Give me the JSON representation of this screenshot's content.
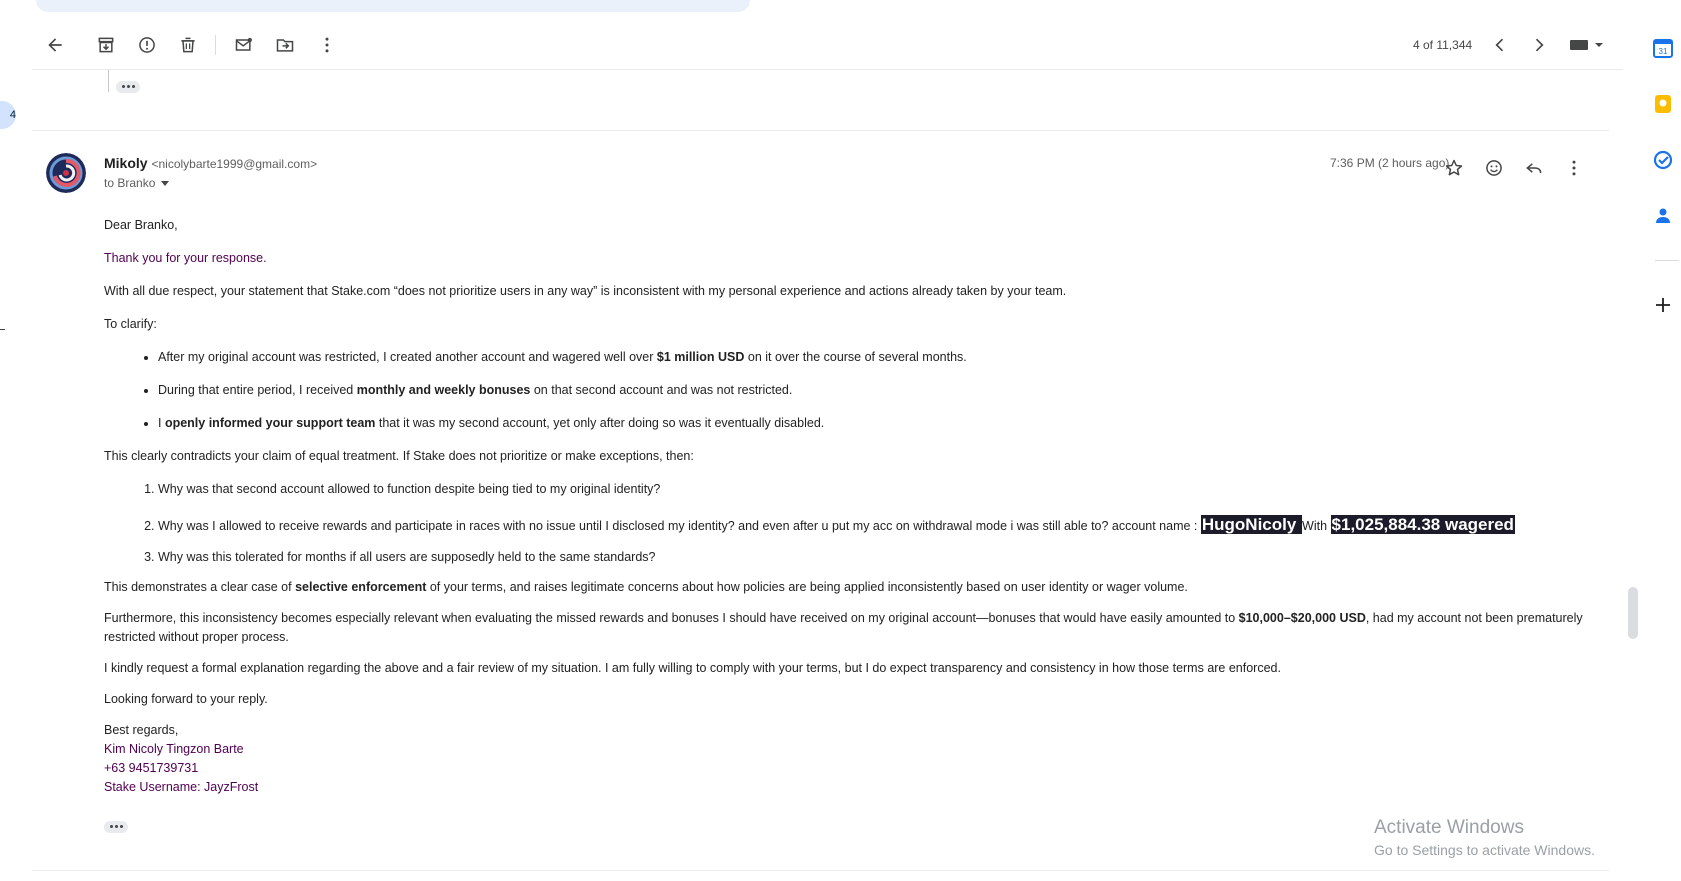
{
  "toolbar": {
    "back_icon": "arrow-left-icon",
    "archive_icon": "archive-icon",
    "spam_icon": "report-spam-icon",
    "delete_icon": "trash-icon",
    "mark_unread_icon": "mark-unread-icon",
    "move_icon": "move-to-icon",
    "more_icon": "more-vert-icon",
    "counter": "4 of 11,344",
    "older_icon": "chevron-left-icon",
    "newer_icon": "chevron-right-icon",
    "input_tools_icon": "keyboard-icon"
  },
  "message": {
    "sender_name": "Mikoly",
    "sender_email": "<nicolybarte1999@gmail.com>",
    "to": "to Branko",
    "timestamp": "7:36 PM (2 hours ago)",
    "greeting": "Dear Branko,",
    "thanks": "Thank you for your response.",
    "p1": "With all due respect, your statement that Stake.com “does not prioritize users in any way” is inconsistent with my personal experience and actions already taken by your team.",
    "clarify": "To clarify:",
    "bullets": [
      {
        "a": "After my original account was restricted, I created another account and wagered well over ",
        "b": "$1 million USD",
        "c": " on it over the course of several months."
      },
      {
        "a": "During that entire period, I received ",
        "b": "monthly and weekly bonuses",
        "c": " on that second account and was not restricted."
      },
      {
        "a": "I ",
        "b": "openly informed your support team",
        "c": " that it was my second account, yet only after doing so was it eventually disabled."
      }
    ],
    "p2": "This clearly contradicts your claim of equal treatment. If Stake does not prioritize or make exceptions, then:",
    "q1": "Why was that second account allowed to function despite being tied to my original identity?",
    "q2_text": "Why was I allowed to receive rewards and participate in races with no issue until I disclosed my identity? and even after u put my acc on withdrawal mode i was still able to? account name : ",
    "q2_name": "HugoNicoly ",
    "q2_with": " With ",
    "q2_wager": "$1,025,884.38 wagered",
    "q3": "Why was this tolerated for months if all users are supposedly held to the same standards?",
    "p3a": "This demonstrates a clear case of ",
    "p3b": "selective enforcement",
    "p3c": " of your terms, and raises legitimate concerns about how policies are being applied inconsistently based on user identity or wager volume.",
    "p4a": "Furthermore, this inconsistency becomes especially relevant when evaluating the missed rewards and bonuses I should have received on my original account—bonuses that would have easily amounted to ",
    "p4b": "$10,000–$20,000 USD",
    "p4c": ", had my account not been prematurely restricted without proper process.",
    "p5": "I kindly request a formal explanation regarding the above and a fair review of my situation. I am fully willing to comply with your terms, but I do expect transparency and consistency in how those terms are enforced.",
    "p6": "Looking forward to your reply.",
    "closing": "Best regards,",
    "sig_name": "Kim Nicoly Tingzon Barte",
    "sig_phone": "+63 9451739731",
    "sig_username": "Stake Username: JayzFrost"
  },
  "actions": {
    "star_icon": "star-icon",
    "emoji_icon": "emoji-icon",
    "reply_icon": "reply-icon",
    "more_icon": "more-vert-icon"
  },
  "side_panel": [
    "calendar-icon",
    "keep-icon",
    "tasks-icon",
    "contacts-icon",
    "add-icon"
  ],
  "watermark": {
    "line1": "Activate Windows",
    "line2": "Go to Settings to activate Windows."
  },
  "left_badge": "4"
}
